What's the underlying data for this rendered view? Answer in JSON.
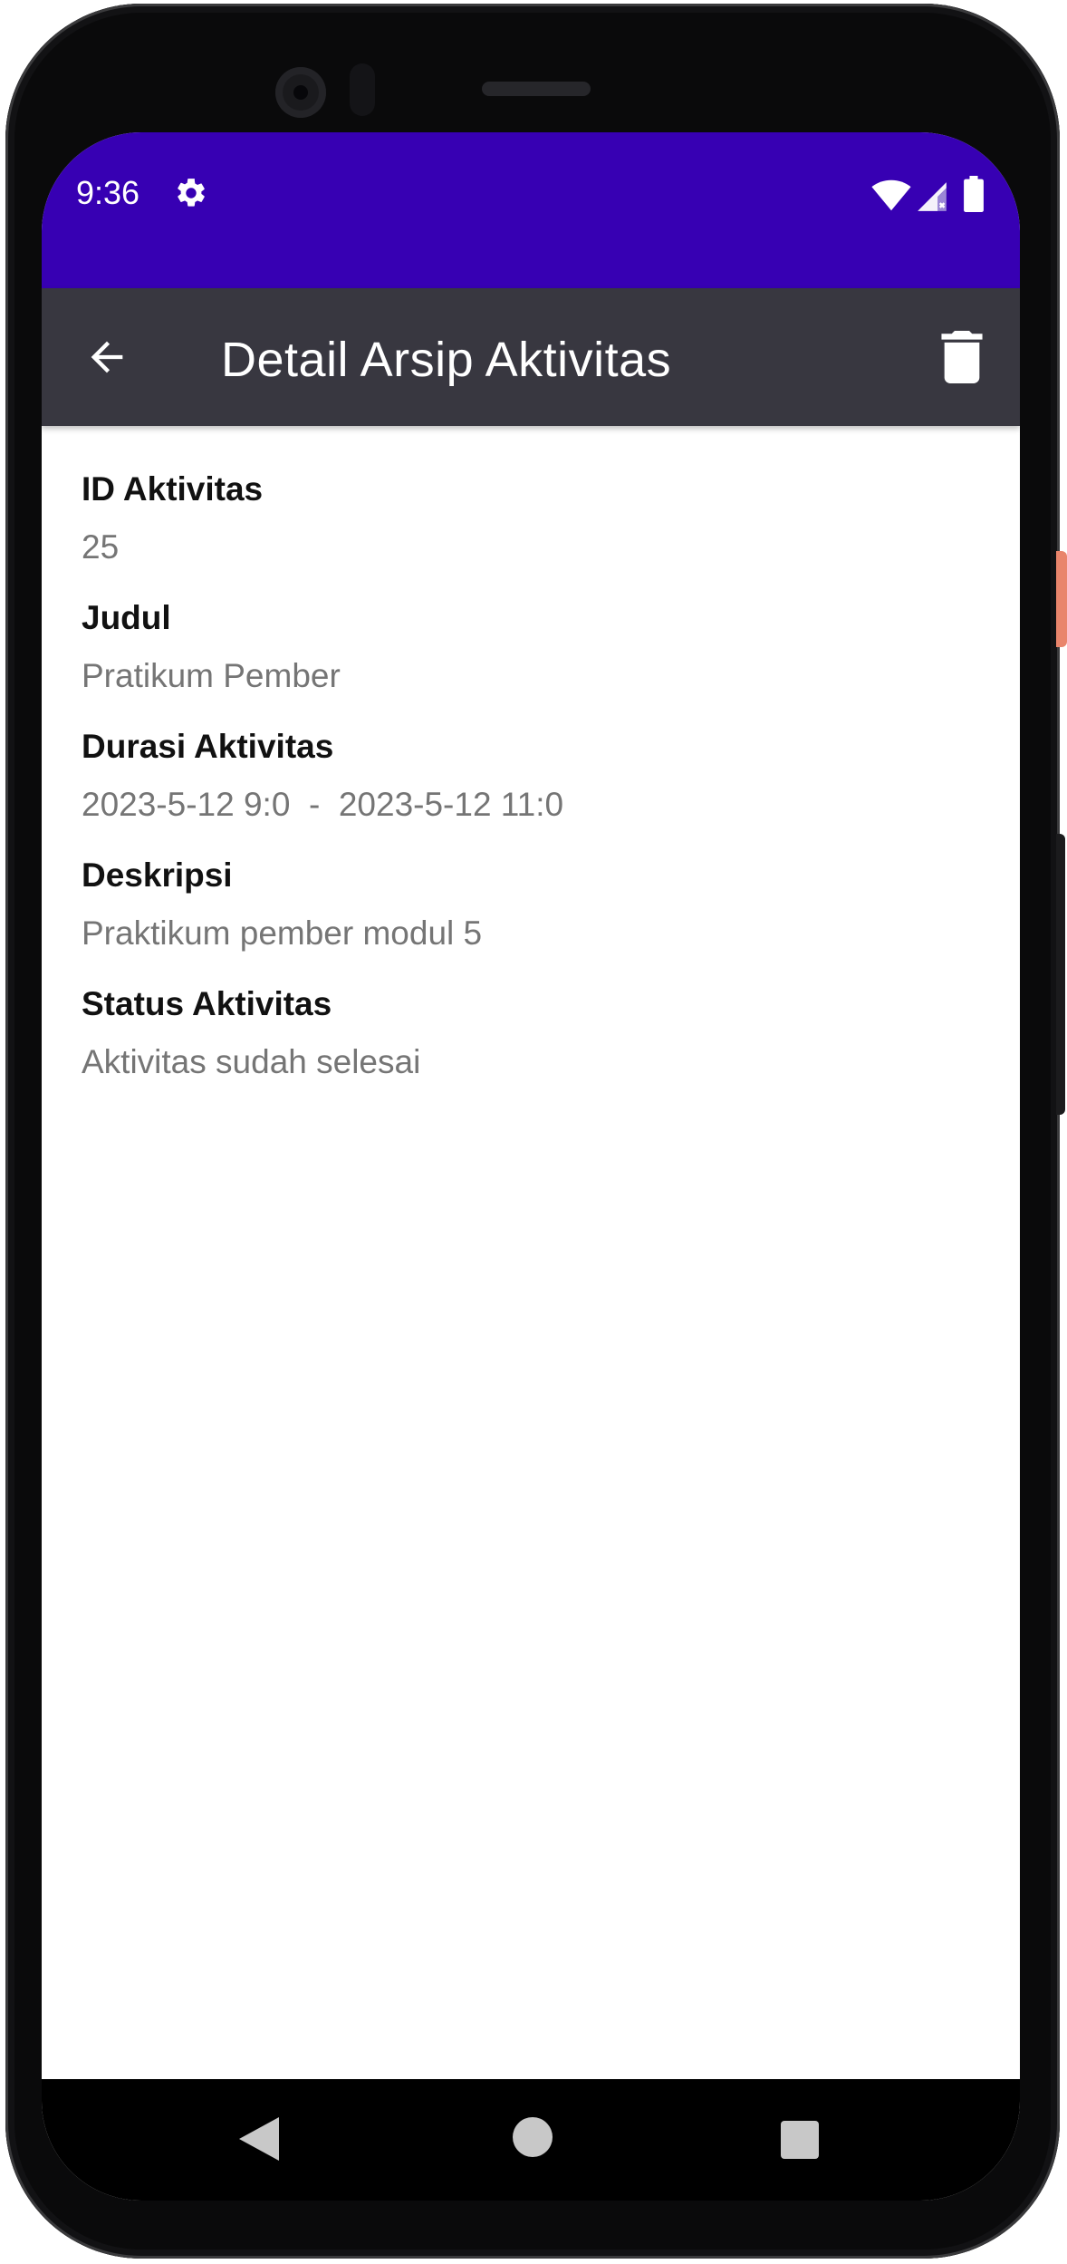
{
  "status_bar": {
    "time": "9:36",
    "icons": [
      "gear-icon",
      "wifi-icon",
      "cell-signal-icon",
      "battery-icon"
    ],
    "color": "#3700b3"
  },
  "app_bar": {
    "title": "Detail Arsip Aktivitas",
    "back_icon": "arrow-back-icon",
    "delete_icon": "trash-icon",
    "color": "#383740"
  },
  "details": {
    "id": {
      "label": "ID Aktivitas",
      "value": "25"
    },
    "judul": {
      "label": "Judul",
      "value": "Pratikum Pember"
    },
    "durasi": {
      "label": "Durasi Aktivitas",
      "value": "2023-5-12 9:0  -  2023-5-12 11:0"
    },
    "deskripsi": {
      "label": "Deskripsi",
      "value": "Praktikum pember modul 5"
    },
    "status": {
      "label": "Status Aktivitas",
      "value": "Aktivitas sudah selesai"
    }
  },
  "nav_bar": {
    "icons": [
      "nav-back-icon",
      "nav-home-icon",
      "nav-recents-icon"
    ]
  }
}
